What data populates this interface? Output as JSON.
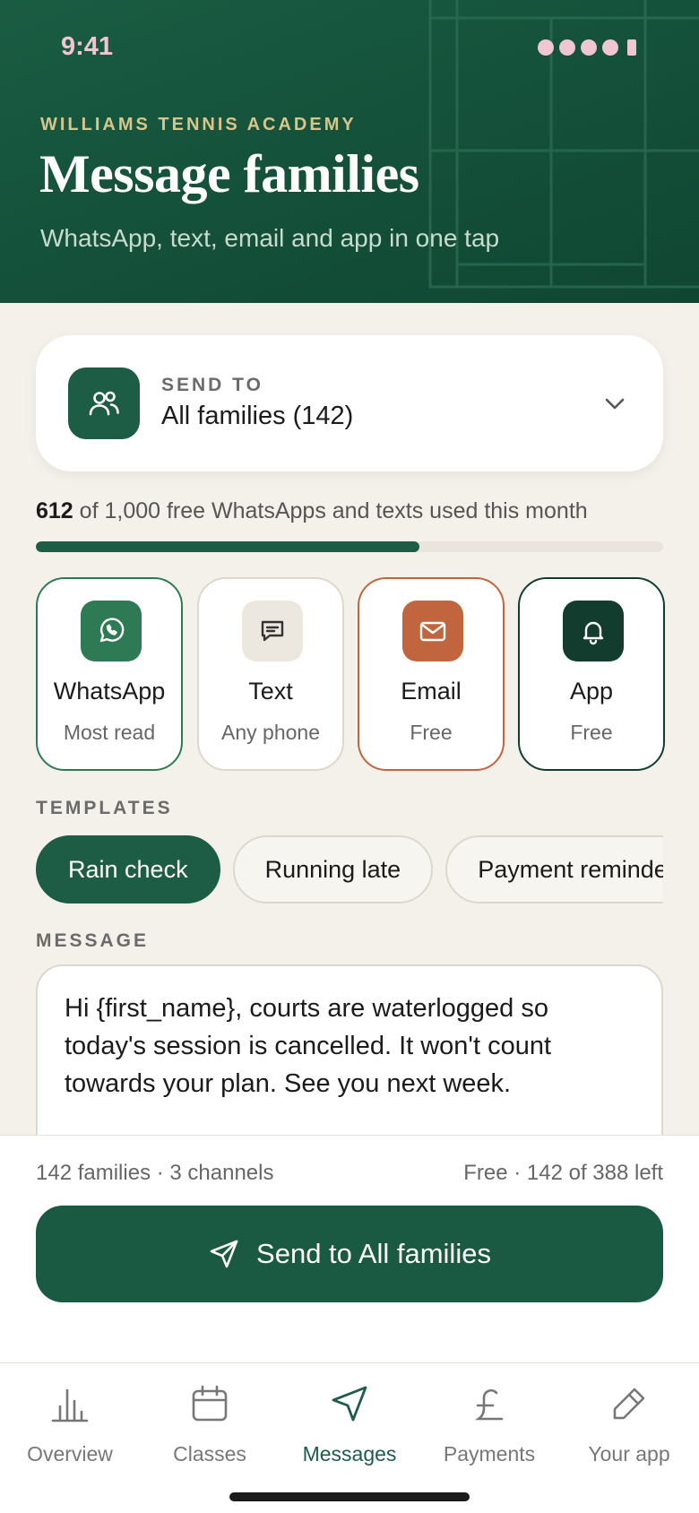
{
  "status": {
    "time": "9:41"
  },
  "header": {
    "eyebrow": "WILLIAMS TENNIS ACADEMY",
    "title": "Message families",
    "subtitle": "WhatsApp, text, email and app in one tap"
  },
  "send_to": {
    "label": "SEND TO",
    "value": "All families (142)",
    "icon": "users-icon"
  },
  "usage": {
    "used": "612",
    "text": "of 1,000 free WhatsApps and texts used this month",
    "fraction": 0.612
  },
  "channels": [
    {
      "name": "WhatsApp",
      "sub": "Most read",
      "icon": "whatsapp-icon",
      "color": "#2e7a54"
    },
    {
      "name": "Text",
      "sub": "Any phone",
      "icon": "chat-icon",
      "color": "#ece8df"
    },
    {
      "name": "Email",
      "sub": "Free",
      "icon": "mail-icon",
      "color": "#c0653e"
    },
    {
      "name": "App",
      "sub": "Free",
      "icon": "bell-icon",
      "color": "#123d2e"
    }
  ],
  "templates": {
    "label": "TEMPLATES",
    "items": [
      "Rain check",
      "Running late",
      "Payment reminder"
    ]
  },
  "message": {
    "label": "MESSAGE",
    "body": "Hi {first_name}, courts are waterlogged so today's session is cancelled. It won't count towards your plan. See you next week."
  },
  "summary": {
    "left": "142 families · 3 channels",
    "right": "Free · 142 of 388 left"
  },
  "send_button": {
    "label": "Send to All families",
    "icon": "send-icon"
  },
  "tabs": [
    {
      "label": "Overview",
      "icon": "chart-icon"
    },
    {
      "label": "Classes",
      "icon": "calendar-icon"
    },
    {
      "label": "Messages",
      "icon": "send-icon"
    },
    {
      "label": "Payments",
      "icon": "pound-icon"
    },
    {
      "label": "Your app",
      "icon": "pencil-icon"
    }
  ],
  "colors": {
    "brand": "#1d5c45",
    "email_accent": "#c0653e",
    "background": "#f4f1ea"
  }
}
